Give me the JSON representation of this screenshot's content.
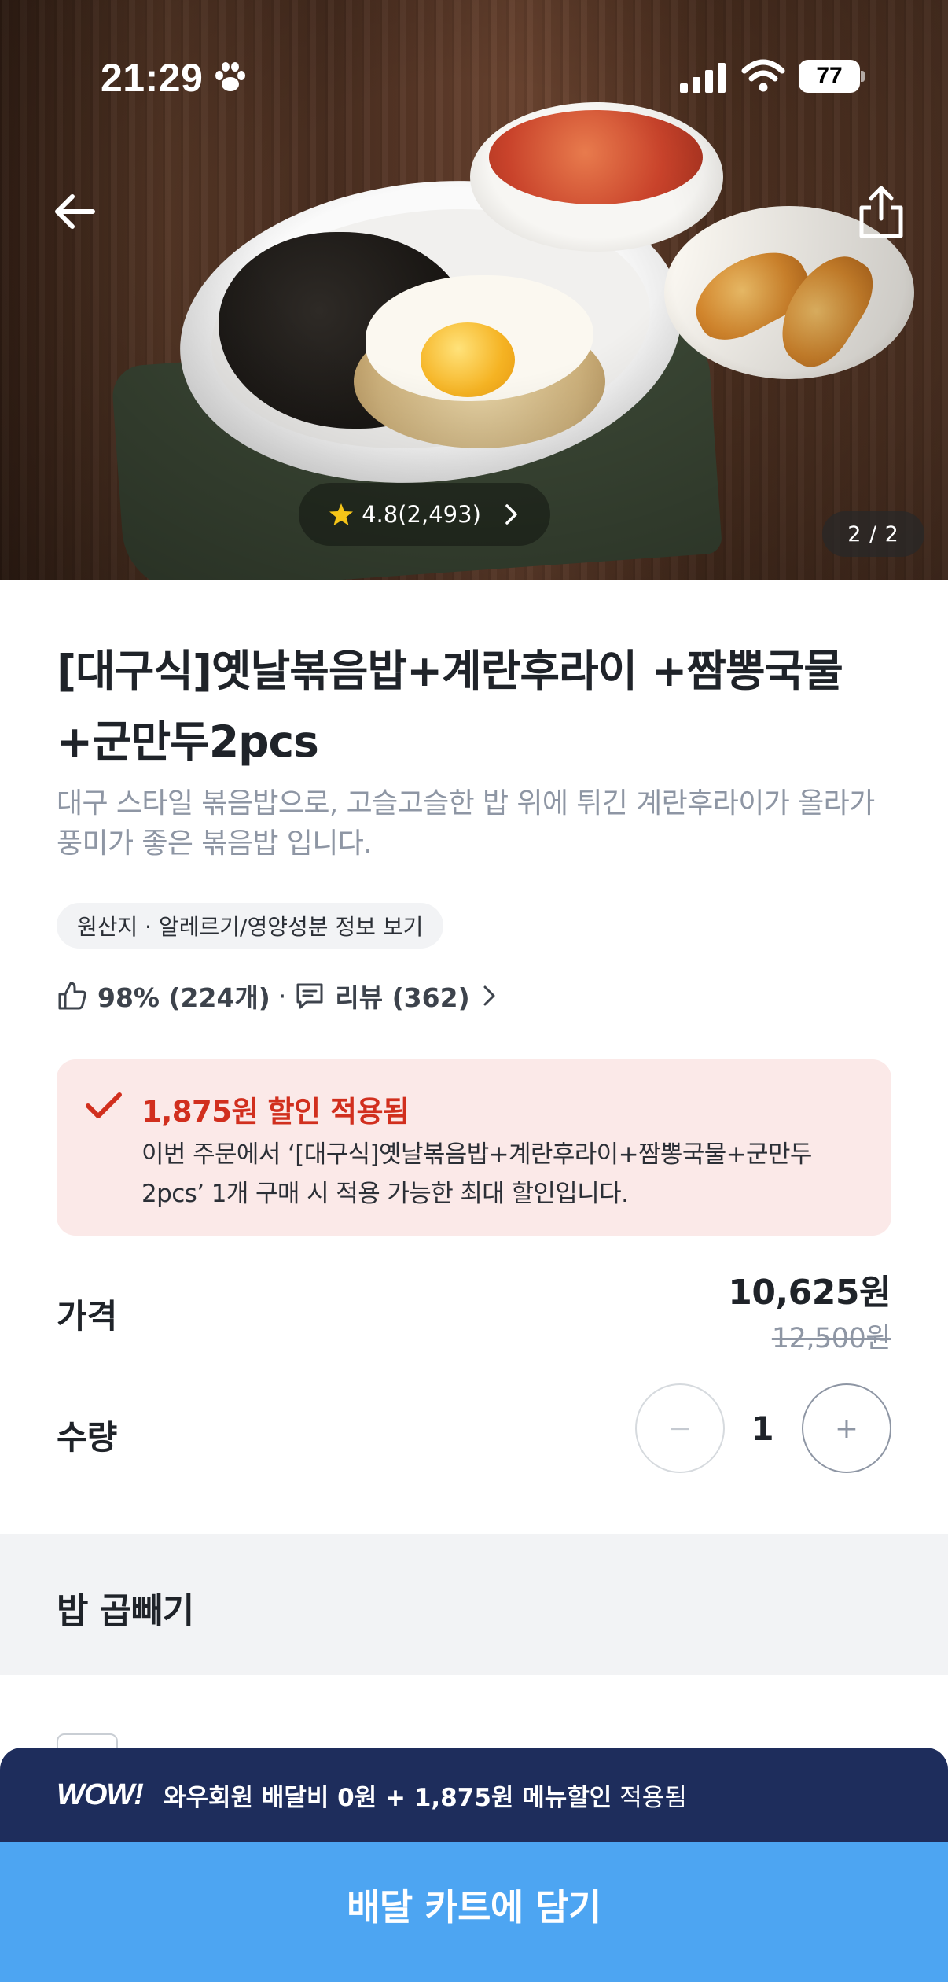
{
  "status_bar": {
    "time": "21:29",
    "battery": "77"
  },
  "hero": {
    "rating": "4.8(2,493)",
    "page_indicator": "2 / 2"
  },
  "product": {
    "title": "[대구식]옛날볶음밥+계란후라이 +짬뽕국물+군만두2pcs",
    "description": "대구 스타일 볶음밥으로, 고슬고슬한 밥 위에 튀긴 계란후라이가 올라가 풍미가 좋은 볶음밥 입니다.",
    "info_chip": "원산지 · 알레르기/영양성분 정보 보기",
    "like_rate": "98% (224개)",
    "review": "리뷰 (362)"
  },
  "discount": {
    "title": "1,875원 할인 적용됨",
    "description": "이번 주문에서 ‘[대구식]옛날볶음밥+계란후라이+짬뽕국물+군만두2pcs’ 1개 구매 시 적용 가능한 최대 할인입니다."
  },
  "price": {
    "label": "가격",
    "current": "10,625원",
    "original": "12,500원"
  },
  "quantity": {
    "label": "수량",
    "value": "1",
    "minus": "−",
    "plus": "+"
  },
  "options_section": {
    "title": "밥 곱빼기"
  },
  "wow_banner": {
    "logo": "WOW!",
    "strong_text": "와우회원 배달비 0원 + 1,875원 메뉴할인",
    "light_text": "적용됨"
  },
  "cta": {
    "label": "배달 카트에 담기"
  },
  "colors": {
    "accent_red": "#d12f1e",
    "cta_blue": "#4da5f2",
    "wow_navy": "#1e2d5c",
    "discount_bg": "#fbe9e8"
  },
  "icons": [
    "paw-icon",
    "signal-icon",
    "wifi-icon",
    "battery-icon",
    "back-arrow-icon",
    "share-icon",
    "star-icon",
    "thumbs-up-icon",
    "comment-icon",
    "chevron-right-icon",
    "check-icon"
  ]
}
